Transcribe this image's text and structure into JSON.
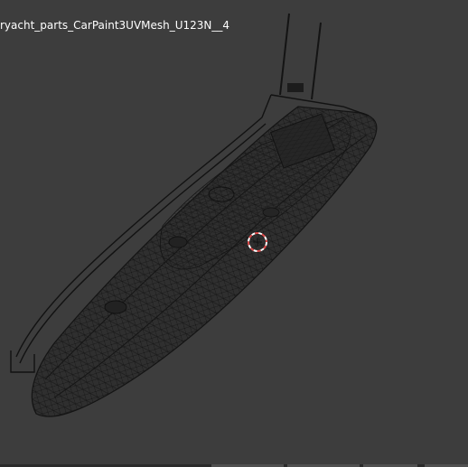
{
  "viewport": {
    "object_name": "ryacht_parts_CarPaint3UVMesh_U123N__4",
    "background_color": "#3d3d3d",
    "wire_color": "#141414",
    "cursor_colors": [
      "#e04a4a",
      "#ffffff"
    ]
  },
  "icons": {
    "cursor": "3d-cursor-icon"
  }
}
